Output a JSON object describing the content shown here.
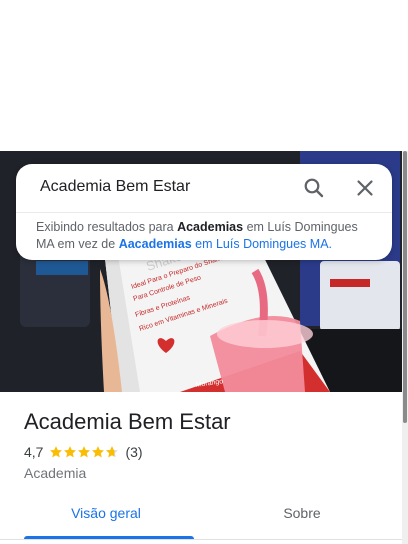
{
  "search": {
    "query": "Academia Bem Estar",
    "notice_prefix": "Exibindo resultados para",
    "notice_term": "Academias",
    "notice_mid": "em Luís Domingues MA em vez de",
    "notice_original": "Aacademias",
    "notice_original_loc": "em Luís Domingues MA.",
    "search_icon": "search-icon",
    "close_icon": "close-icon"
  },
  "photo": {
    "product_label_lines": [
      "Shake",
      "Ideal Para o Preparo do Shake",
      "Para Controle de Peso",
      "Fibras e Proteínas",
      "Rico em Vitaminas e Minerais"
    ],
    "flavor": "Morango"
  },
  "place": {
    "name": "Academia Bem Estar",
    "rating": "4,7",
    "rating_value": 4.7,
    "review_count": "(3)",
    "category": "Academia"
  },
  "tabs": [
    {
      "label": "Visão geral",
      "active": true
    },
    {
      "label": "Sobre",
      "active": false
    }
  ],
  "colors": {
    "accent": "#1a73e8",
    "star": "#fbbc04"
  }
}
